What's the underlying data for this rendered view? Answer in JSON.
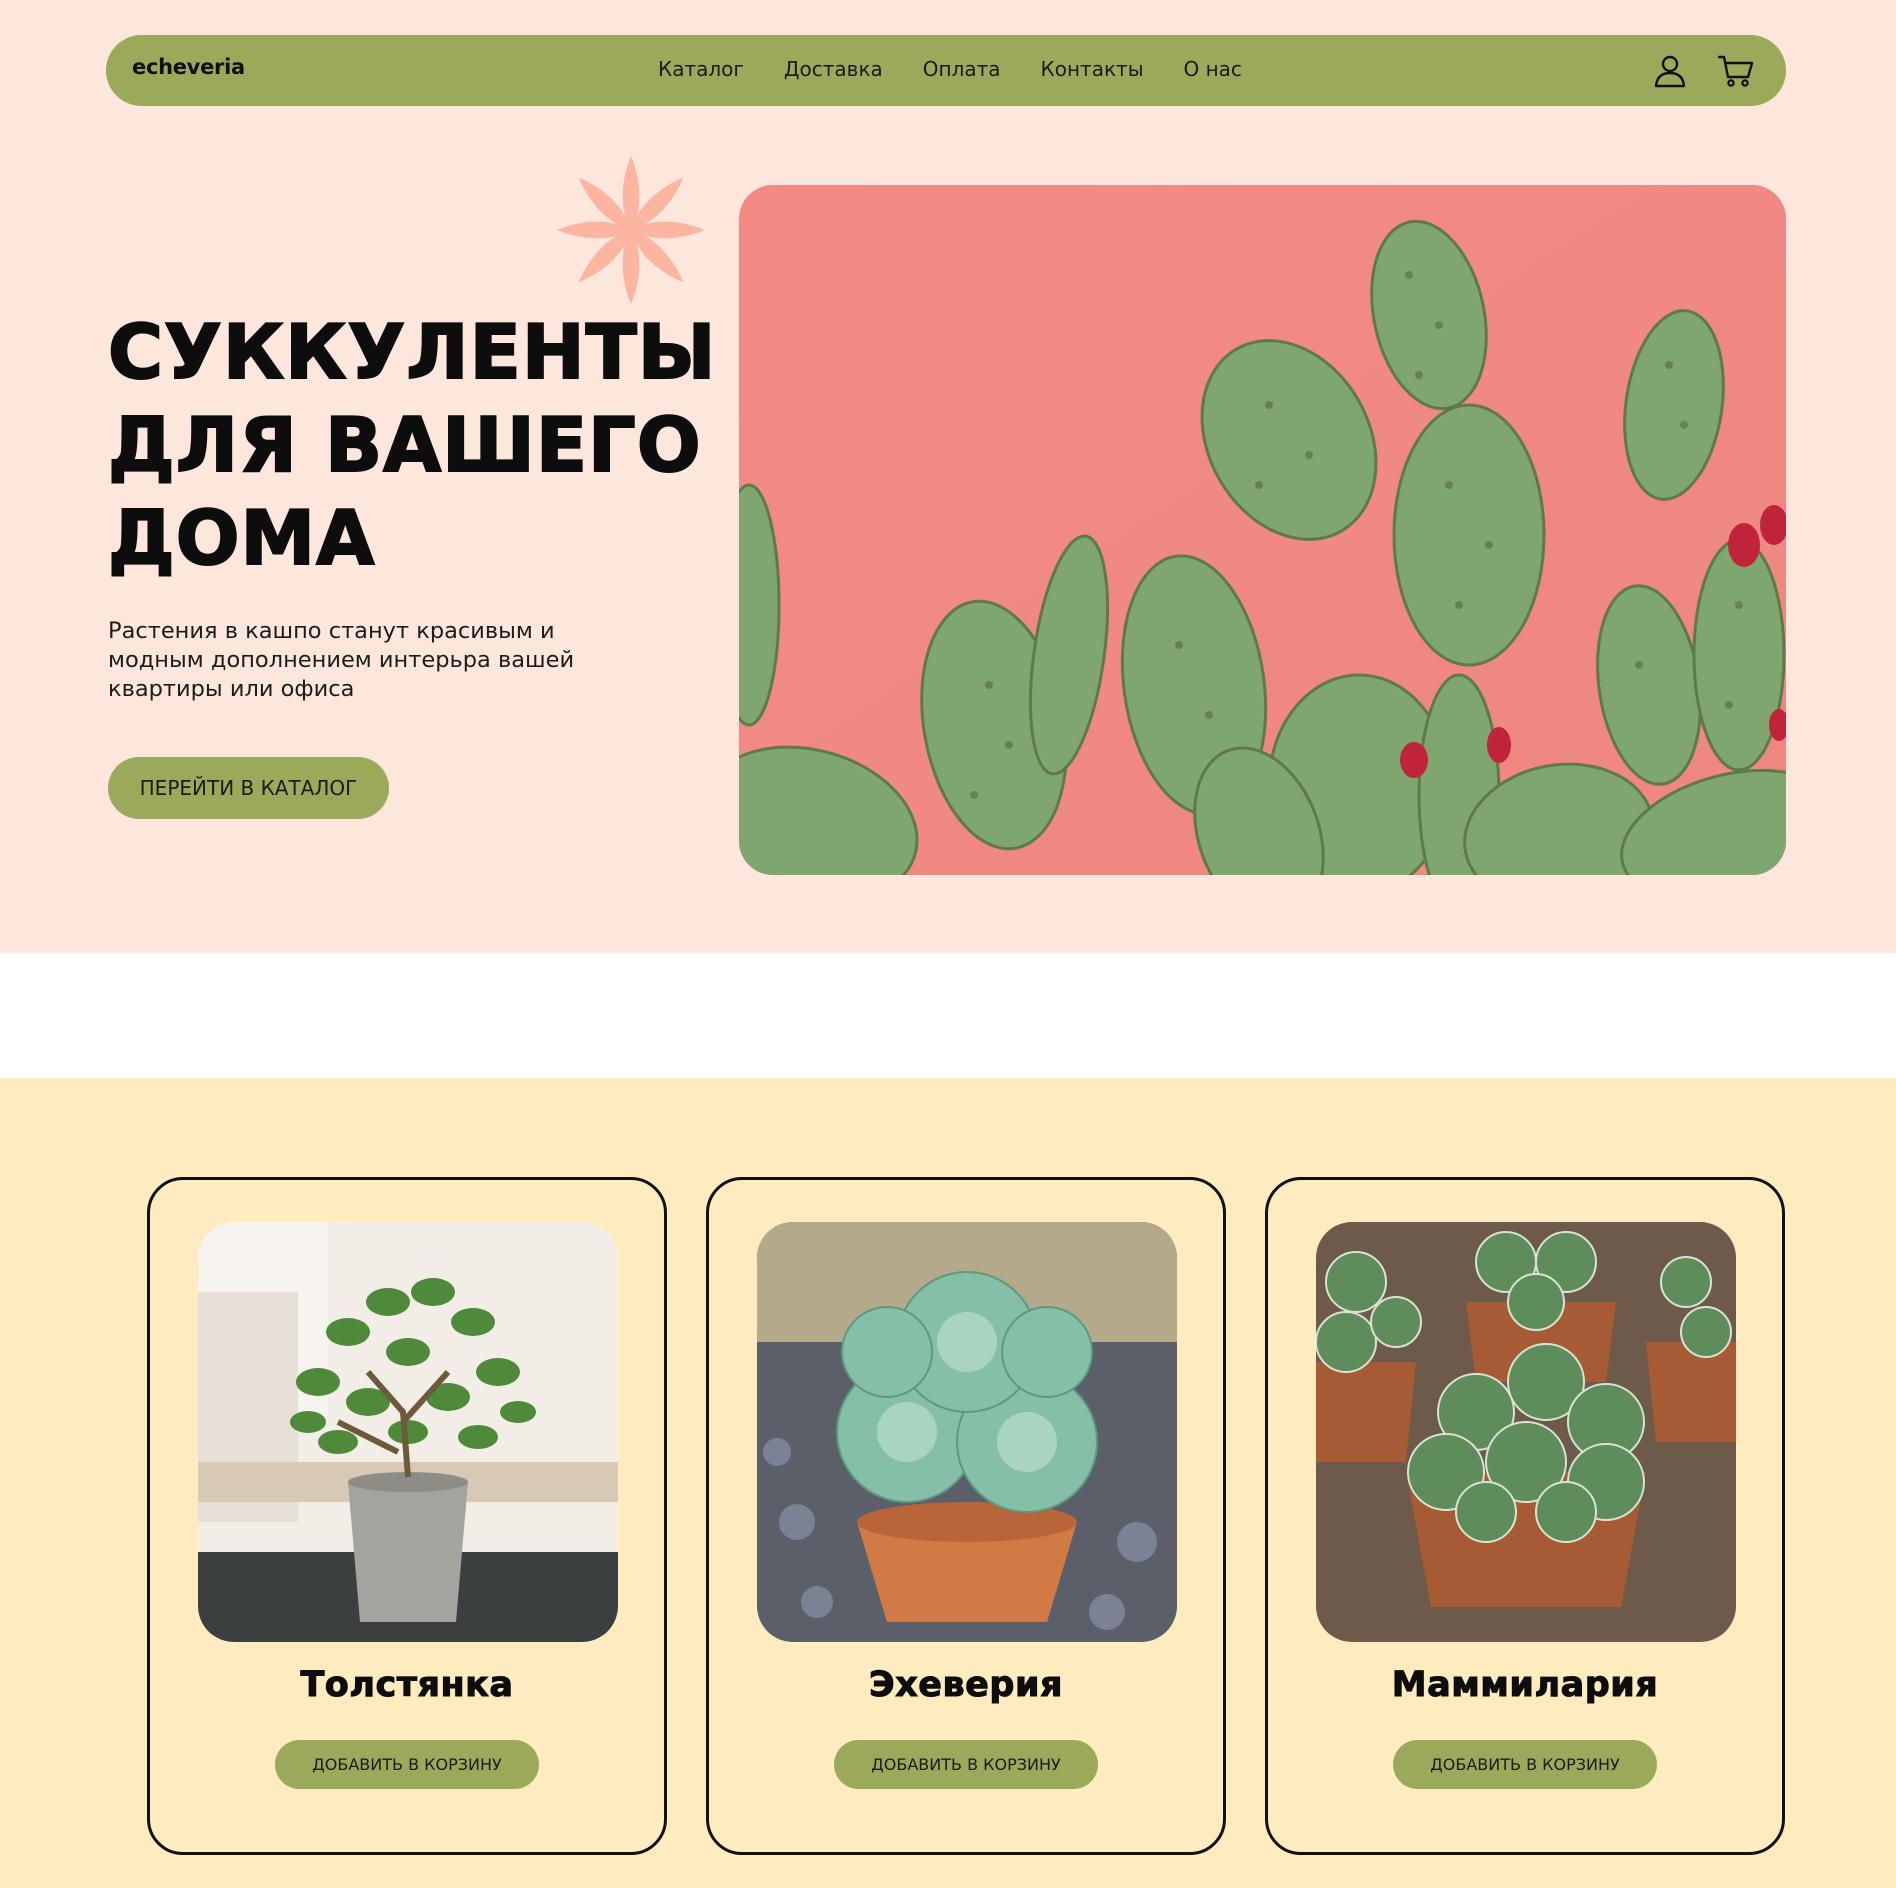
{
  "nav": {
    "logo": "echeveria",
    "menu": [
      {
        "label": "Каталог"
      },
      {
        "label": "Доставка"
      },
      {
        "label": "Оплата"
      },
      {
        "label": "Контакты"
      },
      {
        "label": "О нас"
      }
    ],
    "icons": [
      "user-icon",
      "cart-icon"
    ]
  },
  "hero": {
    "title_lines": [
      "СУККУЛЕНТЫ",
      "ДЛЯ ВАШЕГО",
      "ДОМА"
    ],
    "subtitle_lines": [
      "Растения в кашпо станут красивым и",
      "модным дополнением интерьра вашей",
      "квартиры или офиса"
    ],
    "cta_label": "ПЕРЕЙТИ В КАТАЛОГ",
    "image": "cactus-on-pink-wall-photo",
    "decoration": "pink-flower-icon"
  },
  "products": [
    {
      "name": "Толстянка",
      "button_label": "ДОБАВИТЬ В КОРЗИНУ",
      "image": "crassula-pot-photo"
    },
    {
      "name": "Эхеверия",
      "button_label": "ДОБАВИТЬ В КОРЗИНУ",
      "image": "echeveria-pot-photo"
    },
    {
      "name": "Маммилария",
      "button_label": "ДОБАВИТЬ В КОРЗИНУ",
      "image": "mammillaria-pots-photo"
    }
  ],
  "colors": {
    "accent_green": "#9aa95a",
    "hero_bg": "#fde7dd",
    "products_bg": "#feebc0",
    "flower_pink": "#fbb5a1",
    "photo_pink": "#f08b84"
  }
}
